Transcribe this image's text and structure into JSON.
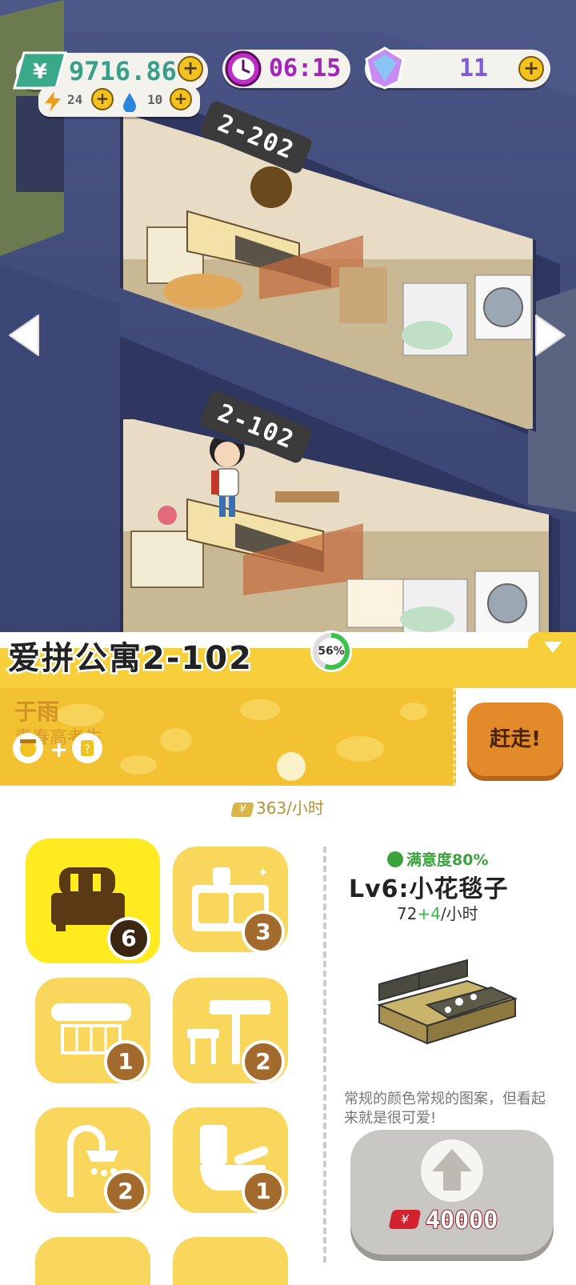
{
  "hud": {
    "money": "9716.86",
    "energy": "24",
    "water": "10",
    "timer": "06:15",
    "gems": "11"
  },
  "rooms": {
    "upper": "2-202",
    "lower": "2-102"
  },
  "apartment": {
    "title": "爱拼公寓2-102",
    "progress_label": "56%",
    "progress_value": 0.56
  },
  "tenant": {
    "name": "于雨",
    "description": "青春高考生",
    "plus_sign": "+",
    "evict_label": "赶走!",
    "rent": "363/小时"
  },
  "furniture": [
    {
      "icon": "bed-icon",
      "count": "6",
      "selected": true
    },
    {
      "icon": "cabinet-icon",
      "count": "3",
      "selected": false
    },
    {
      "icon": "desk-icon",
      "count": "1",
      "selected": false
    },
    {
      "icon": "table-chair-icon",
      "count": "2",
      "selected": false
    },
    {
      "icon": "shower-icon",
      "count": "2",
      "selected": false
    },
    {
      "icon": "toilet-icon",
      "count": "1",
      "selected": false
    }
  ],
  "detail": {
    "satisfaction": "满意度80%",
    "item_name": "Lv6:小花毯子",
    "rate_base": "72",
    "rate_bonus": "+4",
    "rate_unit": "/小时",
    "description": "常规的颜色常规的图案，但看起来就是很可爱!",
    "upgrade_cost": "40000"
  },
  "colors": {
    "accent_yellow": "#f6cf3a",
    "evict_orange": "#e38a2a",
    "money_green": "#3aa98a",
    "timer_purple": "#a423b8",
    "progress_green": "#3ac34a"
  }
}
